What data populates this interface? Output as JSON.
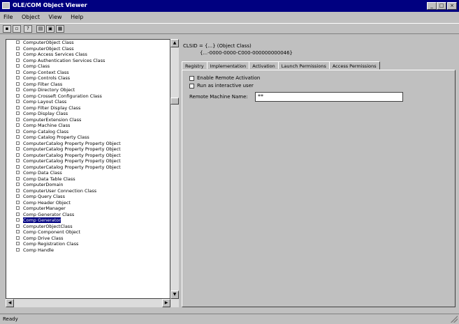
{
  "window": {
    "title": "OLE/COM Object Viewer",
    "minimize": "_",
    "maximize": "□",
    "close": "×"
  },
  "menu": [
    "File",
    "Object",
    "View",
    "Help"
  ],
  "toolbar": [
    {
      "icon": "connect-icon",
      "glyph": "▪"
    },
    {
      "icon": "release-icon",
      "glyph": "▫"
    },
    {
      "icon": "unknown-icon",
      "glyph": "?"
    },
    {
      "icon": "expand-icon",
      "glyph": "▤"
    },
    {
      "icon": "collapse-icon",
      "glyph": "▣"
    },
    {
      "icon": "view-icon",
      "glyph": "▦"
    }
  ],
  "tree": {
    "items": [
      "ComputerObject Class",
      "ComputerObject Class",
      "Comp Access Services Class",
      "Comp Authentication Services Class",
      "Comp Class",
      "Comp Context Class",
      "Comp Controls Class",
      "Comp Filter Class",
      "Comp Directory Object",
      "Comp Crosseft Configuration Class",
      "Comp Layout Class",
      "Comp Filter Display Class",
      "Comp Display Class",
      "ComputerExtension Class",
      "Comp Machine Class",
      "Comp Catalog Class",
      "Comp Catalog Property Class",
      "ComputerCatalog Property Property Object",
      "ComputerCatalog Property Property Object",
      "ComputerCatalog Property Property Object",
      "ComputerCatalog Property Property Object",
      "ComputerCatalog Property Property Object",
      "Comp Data Class",
      "Comp Data Table Class",
      "ComputerDomain",
      "ComputerUser Connection Class",
      "Comp Query Class",
      "Comp Header Object",
      "ComputerManager",
      "Comp Generator Class",
      "Comp Generator",
      "ComputerObjectClass",
      "Comp Component Object",
      "Comp Drive Class",
      "Comp Registration Class",
      "Comp Handle"
    ],
    "selected_index": 30
  },
  "details": {
    "line1": "CLSID = {...} (Object Class)",
    "line2": "{...-0000-0000-C000-000000000046}",
    "tabs": [
      "Registry",
      "Implementation",
      "Activation",
      "Launch Permissions",
      "Access Permissions"
    ],
    "active_tab": 0,
    "checkbox1_label": "Enable Remote Activation",
    "checkbox2_label": "Run as interactive user",
    "field_label": "Remote Machine Name:",
    "field_value": "**"
  },
  "status": {
    "text": "Ready"
  }
}
